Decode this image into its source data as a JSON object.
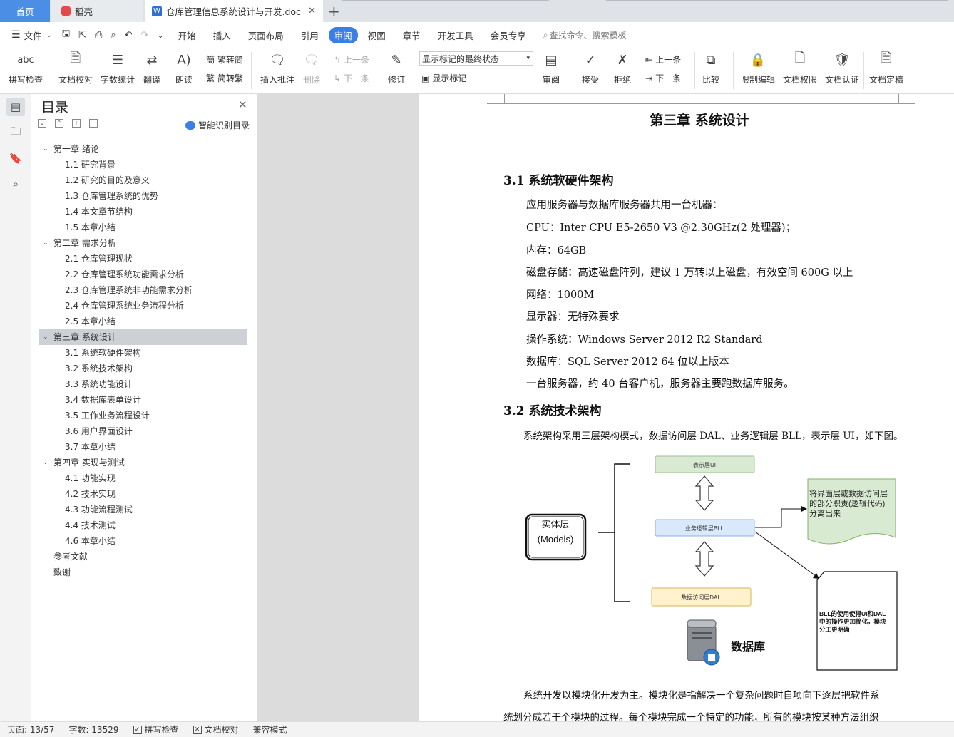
{
  "tabs": {
    "home": "首页",
    "daoke": "稻壳",
    "doc": "仓库管理信息系统设计与开发.doc"
  },
  "menu": {
    "file": "文件",
    "items": [
      "开始",
      "插入",
      "页面布局",
      "引用",
      "审阅",
      "视图",
      "章节",
      "开发工具",
      "会员专享"
    ],
    "active": "审阅",
    "search": "查找命令、搜索模板"
  },
  "ribbon": {
    "spell": "拼写检查",
    "proof": "文档校对",
    "wordcount": "字数统计",
    "translate": "翻译",
    "read": "朗读",
    "t2s": "繁转简",
    "s2t": "简转繁",
    "insert_comment": "插入批注",
    "delete": "删除",
    "prev": "上一条",
    "next": "下一条",
    "revise": "修订",
    "markup_state": "显示标记的最终状态",
    "show_markup": "显示标记",
    "review": "审阅",
    "accept": "接受",
    "reject": "拒绝",
    "prev2": "上一条",
    "next2": "下一条",
    "compare": "比较",
    "restrict": "限制编辑",
    "perm": "文档权限",
    "cert": "文档认证",
    "final": "文档定稿"
  },
  "toc": {
    "title": "目录",
    "smart": "智能识别目录",
    "items": [
      {
        "text": "第一章  绪论",
        "level": 1
      },
      {
        "text": "1.1  研究背景",
        "level": 2
      },
      {
        "text": "1.2  研究的目的及意义",
        "level": 2
      },
      {
        "text": "1.3  仓库管理系统的优势",
        "level": 2
      },
      {
        "text": "1.4  本文章节结构",
        "level": 2
      },
      {
        "text": "1.5 本章小结",
        "level": 2
      },
      {
        "text": "第二章  需求分析",
        "level": 1
      },
      {
        "text": "2.1  仓库管理现状",
        "level": 2
      },
      {
        "text": "2.2  仓库管理系统功能需求分析",
        "level": 2
      },
      {
        "text": "2.3 仓库管理系统非功能需求分析",
        "level": 2
      },
      {
        "text": "2.4 仓库管理系统业务流程分析",
        "level": 2
      },
      {
        "text": "2.5 本章小结",
        "level": 2
      },
      {
        "text": "第三章  系统设计",
        "level": 1,
        "selected": true
      },
      {
        "text": "3.1  系统软硬件架构",
        "level": 2
      },
      {
        "text": "3.2  系统技术架构",
        "level": 2
      },
      {
        "text": "3.3 系统功能设计",
        "level": 2
      },
      {
        "text": "3.4 数据库表单设计",
        "level": 2
      },
      {
        "text": "3.5 工作业务流程设计",
        "level": 2
      },
      {
        "text": "3.6  用户界面设计",
        "level": 2
      },
      {
        "text": "3.7 本章小结",
        "level": 2
      },
      {
        "text": "第四章  实现与测试",
        "level": 1
      },
      {
        "text": "4.1  功能实现",
        "level": 2
      },
      {
        "text": "4.2  技术实现",
        "level": 2
      },
      {
        "text": "4.3 功能流程测试",
        "level": 2
      },
      {
        "text": "4.4  技术测试",
        "level": 2
      },
      {
        "text": "4.6 本章小结",
        "level": 2
      },
      {
        "text": "参考文献",
        "level": 0
      },
      {
        "text": "致谢",
        "level": 0
      }
    ]
  },
  "doc": {
    "chapter": "第三章  系统设计",
    "h31": "3.1  系统软硬件架构",
    "lines31": [
      "应用服务器与数据库服务器共用一台机器：",
      "CPU：Inter CPU E5-2650 V3 @2.30GHz(2 处理器)；",
      "内存：64GB",
      "磁盘存储：高速磁盘阵列，建议 1 万转以上磁盘，有效空间 600G 以上",
      "网络：1000M",
      "显示器：无特殊要求",
      "操作系统：Windows Server 2012 R2 Standard",
      "数据库：SQL Server 2012 64 位以上版本",
      "一台服务器，约 40 台客户机，服务器主要跑数据库服务。"
    ],
    "h32": "3.2  系统技术架构",
    "p32": "系统架构采用三层架构模式，数据访问层 DAL、业务逻辑层 BLL，表示层 UI，如下图。",
    "para_end1": "系统开发以模块化开发为主。模块化是指解决一个复杂问题时自项向下逐层把软件系",
    "para_end2": "统划分成若干个模块的过程。每个模块完成一个特定的功能，所有的模块按某种方法组织",
    "diagram": {
      "entity_line1": "实体层",
      "entity_line2": "(Models)",
      "ui": "表示层UI",
      "bll": "业务逻辑层BLL",
      "dal": "数据访问层DAL",
      "db": "数据库",
      "note1_line1": "将界面层或数据访问层",
      "note1_line2": "的部分职责(逻辑代码)",
      "note1_line3": "分离出来",
      "note2_line1": "BLL的使用使得UI和DAL",
      "note2_line2": "中的操作更加简化，模块",
      "note2_line3": "分工更明确"
    }
  },
  "status": {
    "page": "页面: 13/57",
    "words": "字数: 13529",
    "spell": "拼写检查",
    "proof": "文档校对",
    "compat": "兼容模式"
  }
}
